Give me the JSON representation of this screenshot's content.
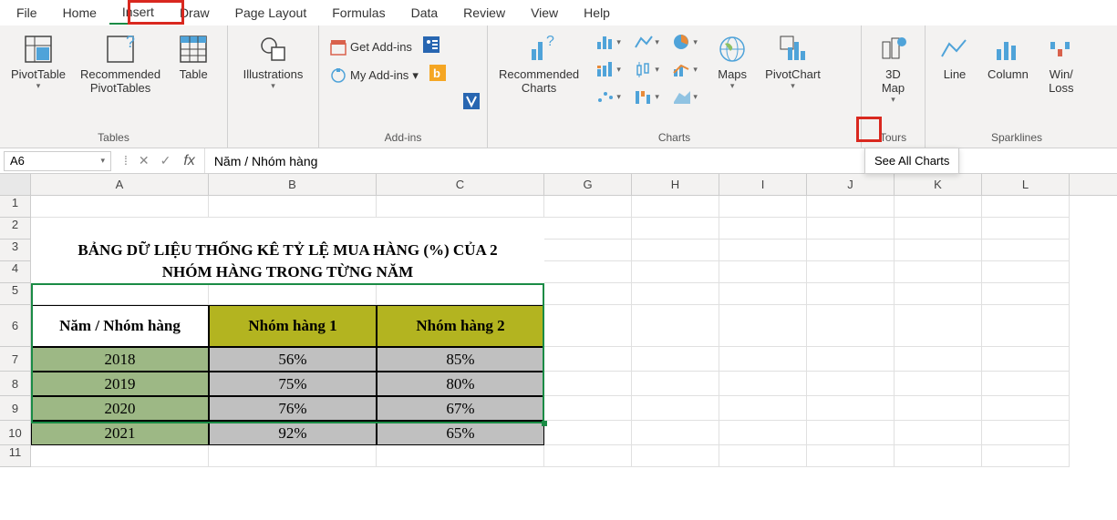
{
  "tabs": [
    "File",
    "Home",
    "Insert",
    "Draw",
    "Page Layout",
    "Formulas",
    "Data",
    "Review",
    "View",
    "Help"
  ],
  "active_tab_index": 2,
  "ribbon": {
    "tables": {
      "label": "Tables",
      "pivot": "PivotTable",
      "recpivot": "Recommended\nPivotTables",
      "table": "Table"
    },
    "illus": {
      "label": "Illustrations"
    },
    "addins": {
      "label": "Add-ins",
      "get": "Get Add-ins",
      "my": "My Add-ins"
    },
    "charts": {
      "label": "Charts",
      "rec": "Recommended\nCharts",
      "maps": "Maps",
      "pivotchart": "PivotChart"
    },
    "tours": {
      "label": "Tours",
      "map3d": "3D\nMap"
    },
    "spark": {
      "label": "Sparklines",
      "line": "Line",
      "col": "Column",
      "winloss": "Win/\nLoss"
    }
  },
  "tooltip": "See All Charts",
  "namebox": "A6",
  "formula": "Năm / Nhóm hàng",
  "cols": {
    "A": 195,
    "B": 184,
    "C": 184,
    "G": 96,
    "H": 96,
    "I": 96,
    "J": 96,
    "K": 96,
    "L": 96
  },
  "title1": "BẢNG DỮ LIỆU THỐNG KÊ TỶ LỆ MUA HÀNG (%) CỦA 2",
  "title2": "NHÓM HÀNG TRONG TỪNG NĂM",
  "headers": [
    "Năm / Nhóm hàng",
    "Nhóm hàng 1",
    "Nhóm hàng 2"
  ],
  "data_rows": [
    [
      "2018",
      "56%",
      "85%"
    ],
    [
      "2019",
      "75%",
      "80%"
    ],
    [
      "2020",
      "76%",
      "67%"
    ],
    [
      "2021",
      "92%",
      "65%"
    ]
  ],
  "chart_data": {
    "type": "table",
    "title": "BẢNG DỮ LIỆU THỐNG KÊ TỶ LỆ MUA HÀNG (%) CỦA 2 NHÓM HÀNG TRONG TỪNG NĂM",
    "categories": [
      "2018",
      "2019",
      "2020",
      "2021"
    ],
    "series": [
      {
        "name": "Nhóm hàng 1",
        "values": [
          56,
          75,
          76,
          92
        ]
      },
      {
        "name": "Nhóm hàng 2",
        "values": [
          85,
          80,
          67,
          65
        ]
      }
    ],
    "unit": "%"
  }
}
